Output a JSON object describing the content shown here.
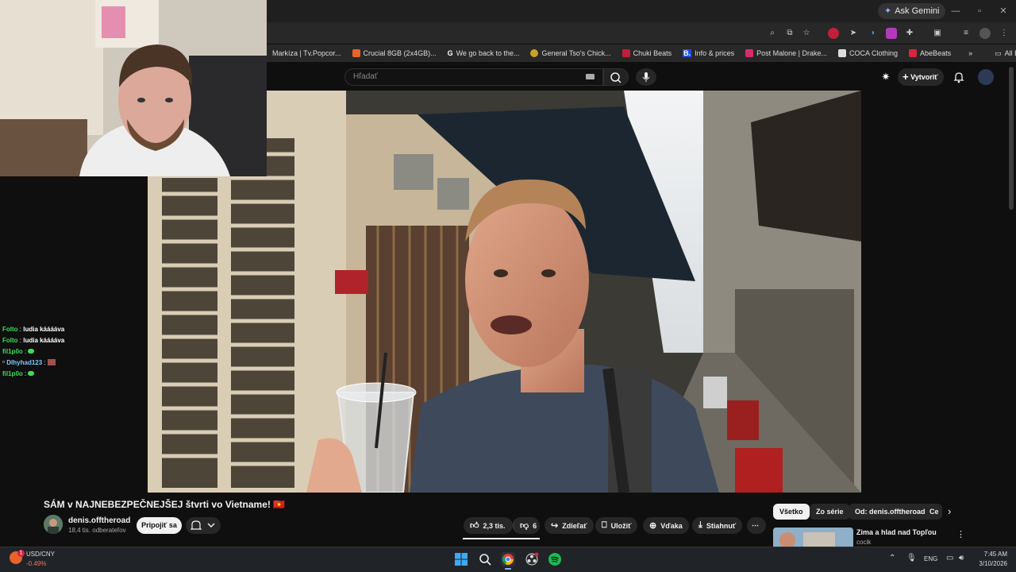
{
  "browser": {
    "ask_gemini": "Ask Gemini",
    "bookmarks": [
      {
        "label": "Markíza | Tv.Popcor...",
        "color": "#1e6fd9"
      },
      {
        "label": "Crucial 8GB (2x4GB)...",
        "color": "#e8632b"
      },
      {
        "label": "We go back to the...",
        "color": "#4285f4",
        "glyph": "G"
      },
      {
        "label": "General Tso's Chick...",
        "color": "#c9a227"
      },
      {
        "label": "Chuki Beats",
        "color": "#c0203a"
      },
      {
        "label": "Info & prices",
        "color": "#1e4fd9",
        "glyph": "B."
      },
      {
        "label": "Post Malone | Drake...",
        "color": "#d52c6b"
      },
      {
        "label": "COCA Clothing",
        "color": "#333333"
      },
      {
        "label": "AbeBeats",
        "color": "#d7263d"
      }
    ],
    "all_bookmarks": "All Bookmarks"
  },
  "youtube": {
    "search_placeholder": "Hľadať",
    "create_label": "Vytvoriť",
    "video_title": "SÁM v NAJNEBEZPEČNEJŠEJ štvrti vo Vietname! 🇻🇳",
    "channel_name": "denis.offtheroad",
    "channel_subs": "18,4 tis. odberateľov",
    "join_label": "Pripojiť sa",
    "likes": "2,3 tis.",
    "dislikes": "6",
    "share_label": "Zdieľať",
    "save_label": "Uložiť",
    "thanks_label": "Vďaka",
    "download_label": "Stiahnuť",
    "chips": [
      "Všetko",
      "Zo série",
      "Od: denis.offtheroad",
      "Ce"
    ],
    "rec_title": "Zima a hlad nad Topľou",
    "rec_channel": "cocik"
  },
  "chat": [
    {
      "user": "Folto",
      "color": "#3ddc5a",
      "message": "ludia kááááva"
    },
    {
      "user": "Folto",
      "color": "#3ddc5a",
      "message": "ludia kááááva"
    },
    {
      "user": "fil1p0o",
      "color": "#3ddc5a",
      "message": ""
    },
    {
      "user": "Dlhyhad123",
      "color": "#7fc8ff",
      "message": ""
    },
    {
      "user": "fil1p0o",
      "color": "#3ddc5a",
      "message": ""
    }
  ],
  "taskbar": {
    "ticker_name": "USD/CNY",
    "ticker_value": "-0.49%",
    "ticker_badge": "1",
    "language": "ENG",
    "time": "7:45 AM",
    "date": "3/10/2026"
  }
}
